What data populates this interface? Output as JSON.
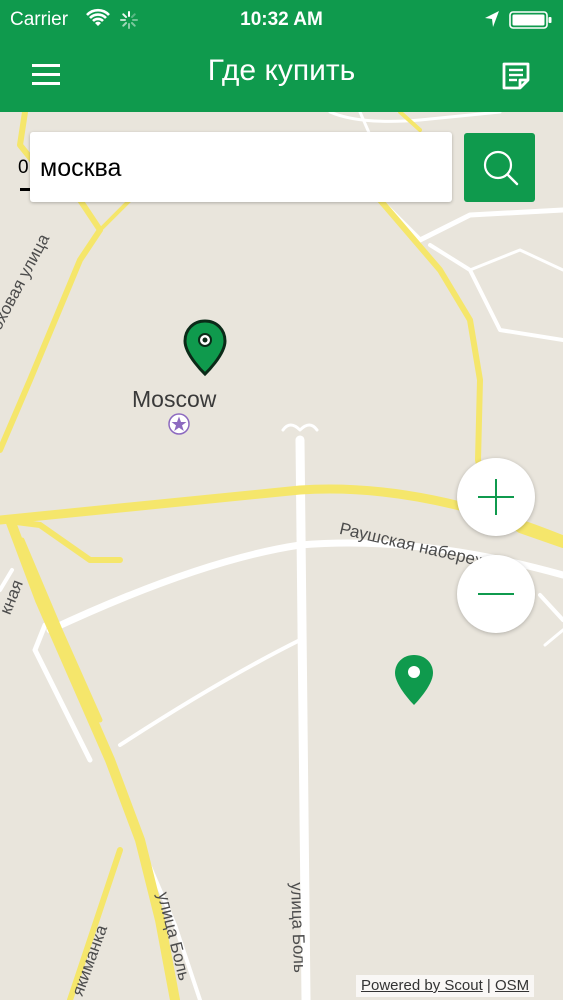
{
  "status_bar": {
    "carrier": "Carrier",
    "time": "10:32 AM",
    "icons": [
      "wifi-icon",
      "activity-spinner-icon",
      "location-arrow-icon",
      "battery-icon"
    ]
  },
  "nav_bar": {
    "title": "Где купить",
    "left_icon": "hamburger-menu-icon",
    "right_icon": "document-list-icon"
  },
  "search": {
    "value": "москва",
    "button_icon": "search-icon"
  },
  "map": {
    "scale_label": "0",
    "city_label": "Moscow",
    "street_labels": {
      "mokhovaya": "Моховая улица",
      "raushskaya": "Раушская набережная",
      "left_fragment": "кная",
      "yakimanka": "якиманка",
      "bolshaya_1": "улица Боль",
      "bolshaya_2": "улица Боль"
    },
    "markers": [
      "pin-icon-moscow",
      "pin-icon-location"
    ],
    "zoom_in_icon": "plus-icon",
    "zoom_out_icon": "minus-icon",
    "attribution": {
      "powered_by": "Powered by Scout",
      "separator": " | ",
      "osm": "OSM"
    },
    "colors": {
      "background": "#e9e5dc",
      "major_road": "#f5e66b",
      "minor_road": "#ffffff",
      "accent": "#0f9a4d"
    }
  }
}
